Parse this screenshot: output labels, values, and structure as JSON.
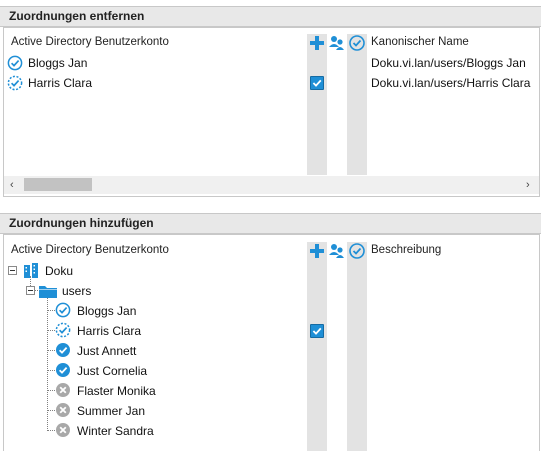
{
  "remove_section": {
    "title": "Zuordnungen entfernen",
    "col_account": "Active Directory Benutzerkonto",
    "col_canonical": "Kanonischer Name",
    "rows": [
      {
        "name": "Bloggs Jan",
        "canonical": "Doku.vi.lan/users/Bloggs Jan",
        "status": "check-circle",
        "checked": false
      },
      {
        "name": "Harris Clara",
        "canonical": "Doku.vi.lan/users/Harris Clara",
        "status": "check-circle-dashed",
        "checked": true
      }
    ],
    "scroll_left": "‹",
    "scroll_right": "›"
  },
  "add_section": {
    "title": "Zuordnungen hinzufügen",
    "col_account": "Active Directory Benutzerkonto",
    "col_description": "Beschreibung",
    "tree": {
      "root_label": "Doku",
      "folder_label": "users",
      "users": [
        {
          "name": "Bloggs Jan",
          "status": "check-circle-outline",
          "checked": false
        },
        {
          "name": "Harris Clara",
          "status": "check-circle-dashed",
          "checked": true
        },
        {
          "name": "Just Annett",
          "status": "check-circle-filled",
          "checked": false
        },
        {
          "name": "Just Cornelia",
          "status": "check-circle-filled",
          "checked": false
        },
        {
          "name": "Flaster Monika",
          "status": "x-circle-gray",
          "checked": false
        },
        {
          "name": "Summer Jan",
          "status": "x-circle-gray",
          "checked": false
        },
        {
          "name": "Winter Sandra",
          "status": "x-circle-gray",
          "checked": false
        }
      ]
    }
  },
  "header_icons": [
    "plus-icon",
    "users-icon",
    "sync-check-icon"
  ],
  "colors": {
    "accent": "#1f8fd6",
    "gray_icon": "#9a9a9a",
    "strip": "#e3e3e3",
    "header_bg": "#e8e8e8"
  }
}
